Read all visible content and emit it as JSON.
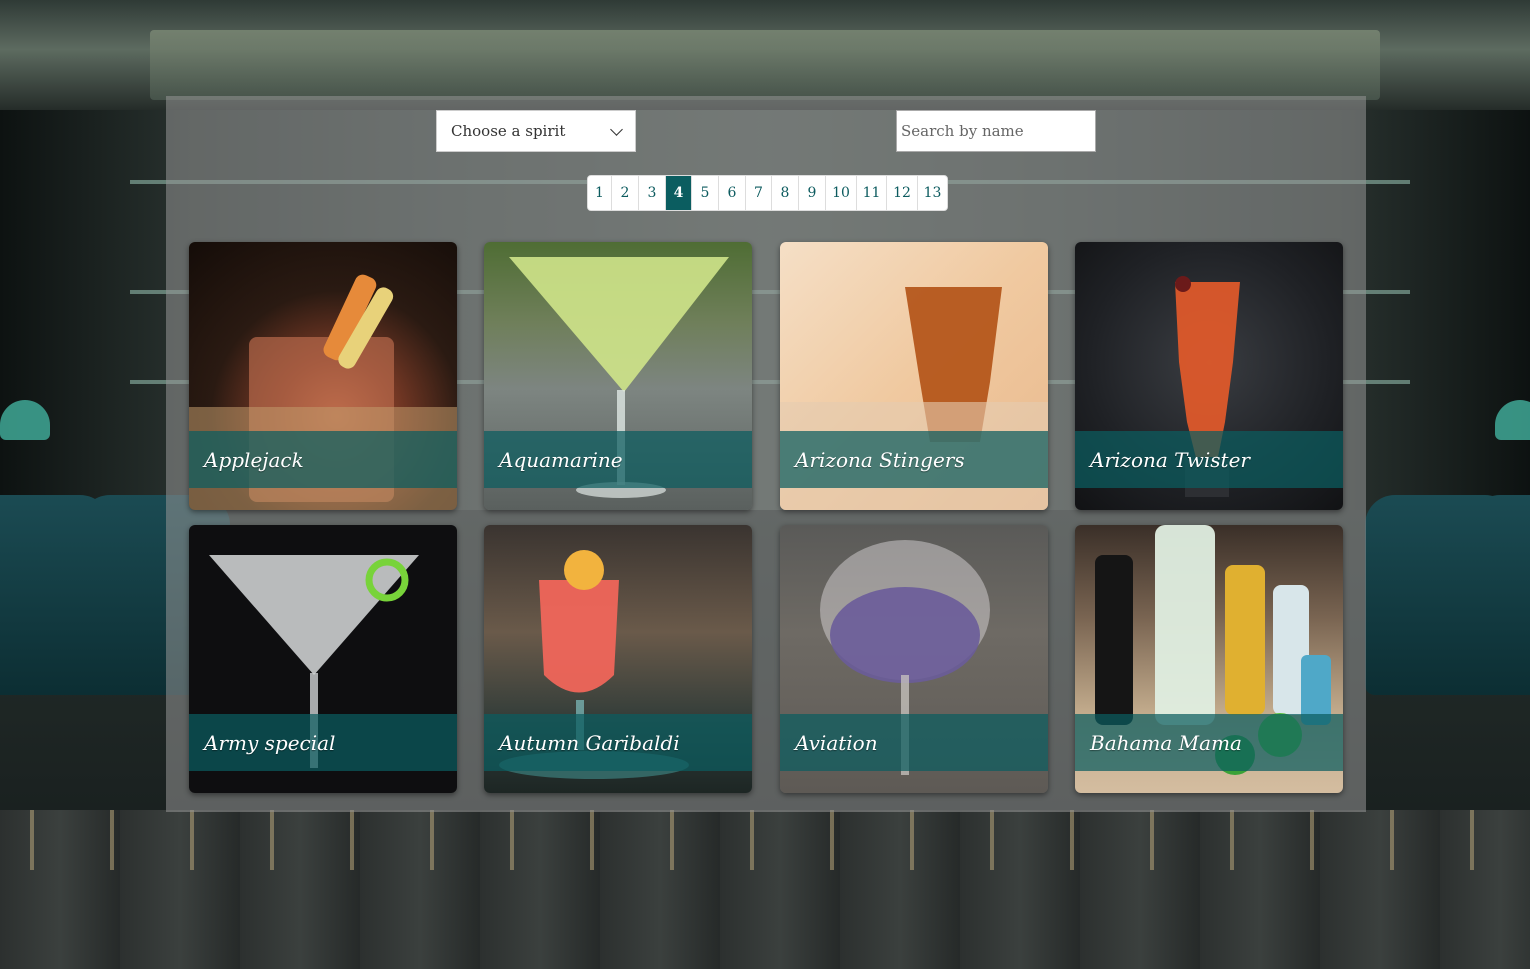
{
  "filters": {
    "spirit_select_label": "Choose a spirit",
    "search_placeholder": "Search by name"
  },
  "pagination": {
    "pages": [
      "1",
      "2",
      "3",
      "4",
      "5",
      "6",
      "7",
      "8",
      "9",
      "10",
      "11",
      "12",
      "13"
    ],
    "current": "4"
  },
  "cocktails": [
    {
      "name": "Applejack"
    },
    {
      "name": "Aquamarine"
    },
    {
      "name": "Arizona Stingers"
    },
    {
      "name": "Arizona Twister"
    },
    {
      "name": "Army special"
    },
    {
      "name": "Autumn Garibaldi"
    },
    {
      "name": "Aviation"
    },
    {
      "name": "Bahama Mama"
    }
  ],
  "colors": {
    "accent": "#0b5d60",
    "caption_overlay": "rgba(11,93,96,0.72)"
  }
}
